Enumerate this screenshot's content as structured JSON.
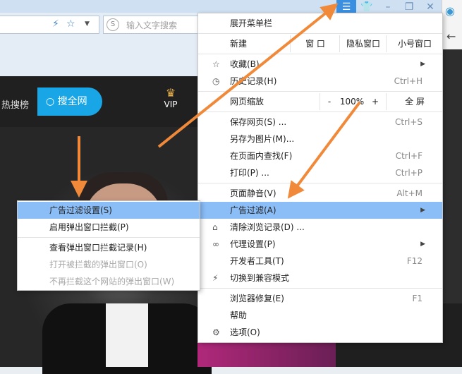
{
  "toolbar": {
    "search_placeholder": "输入文字搜索",
    "icons": [
      "lightning-icon",
      "star-icon",
      "dropdown-icon"
    ]
  },
  "titlebar": {
    "buttons": [
      "menu-icon",
      "skin-icon",
      "minimize-icon",
      "restore-icon",
      "close-icon"
    ]
  },
  "site": {
    "hot_label": "热搜榜",
    "search_button": "搜全网",
    "vip_label": "VIP"
  },
  "menu": {
    "expand_menubar": "展开菜单栏",
    "new": "新建",
    "new_window": "窗 口",
    "private_window": "隐私窗口",
    "small_window": "小号窗口",
    "favorites": "收藏(B)",
    "history": "历史记录(H)",
    "history_shortcut": "Ctrl+H",
    "zoom_label": "网页缩放",
    "zoom_minus": "-",
    "zoom_value": "100%",
    "zoom_plus": "+",
    "fullscreen": "全 屏",
    "save_page": "保存网页(S) ...",
    "save_page_shortcut": "Ctrl+S",
    "save_as_image": "另存为图片(M)...",
    "find": "在页面内查找(F)",
    "find_shortcut": "Ctrl+F",
    "print": "打印(P) ...",
    "print_shortcut": "Ctrl+P",
    "mute": "页面静音(V)",
    "mute_shortcut": "Alt+M",
    "ad_filter": "广告过滤(A)",
    "clear_history": "清除浏览记录(D) ...",
    "proxy": "代理设置(P)",
    "devtools": "开发者工具(T)",
    "devtools_shortcut": "F12",
    "compat_mode": "切换到兼容模式",
    "repair": "浏览器修复(E)",
    "repair_shortcut": "F1",
    "help": "帮助",
    "options": "选项(O)"
  },
  "submenu": {
    "ad_filter_settings": "广告过滤设置(S)",
    "enable_popup_block": "启用弹出窗口拦截(P)",
    "view_popup_log": "查看弹出窗口拦截记录(H)",
    "open_blocked_popup": "打开被拦截的弹出窗口(O)",
    "no_block_site": "不再拦截这个网站的弹出窗口(W)"
  },
  "colors": {
    "highlight": "#8bbdf7",
    "arrow": "#f08a3a",
    "accent_button": "#19a6e6"
  }
}
